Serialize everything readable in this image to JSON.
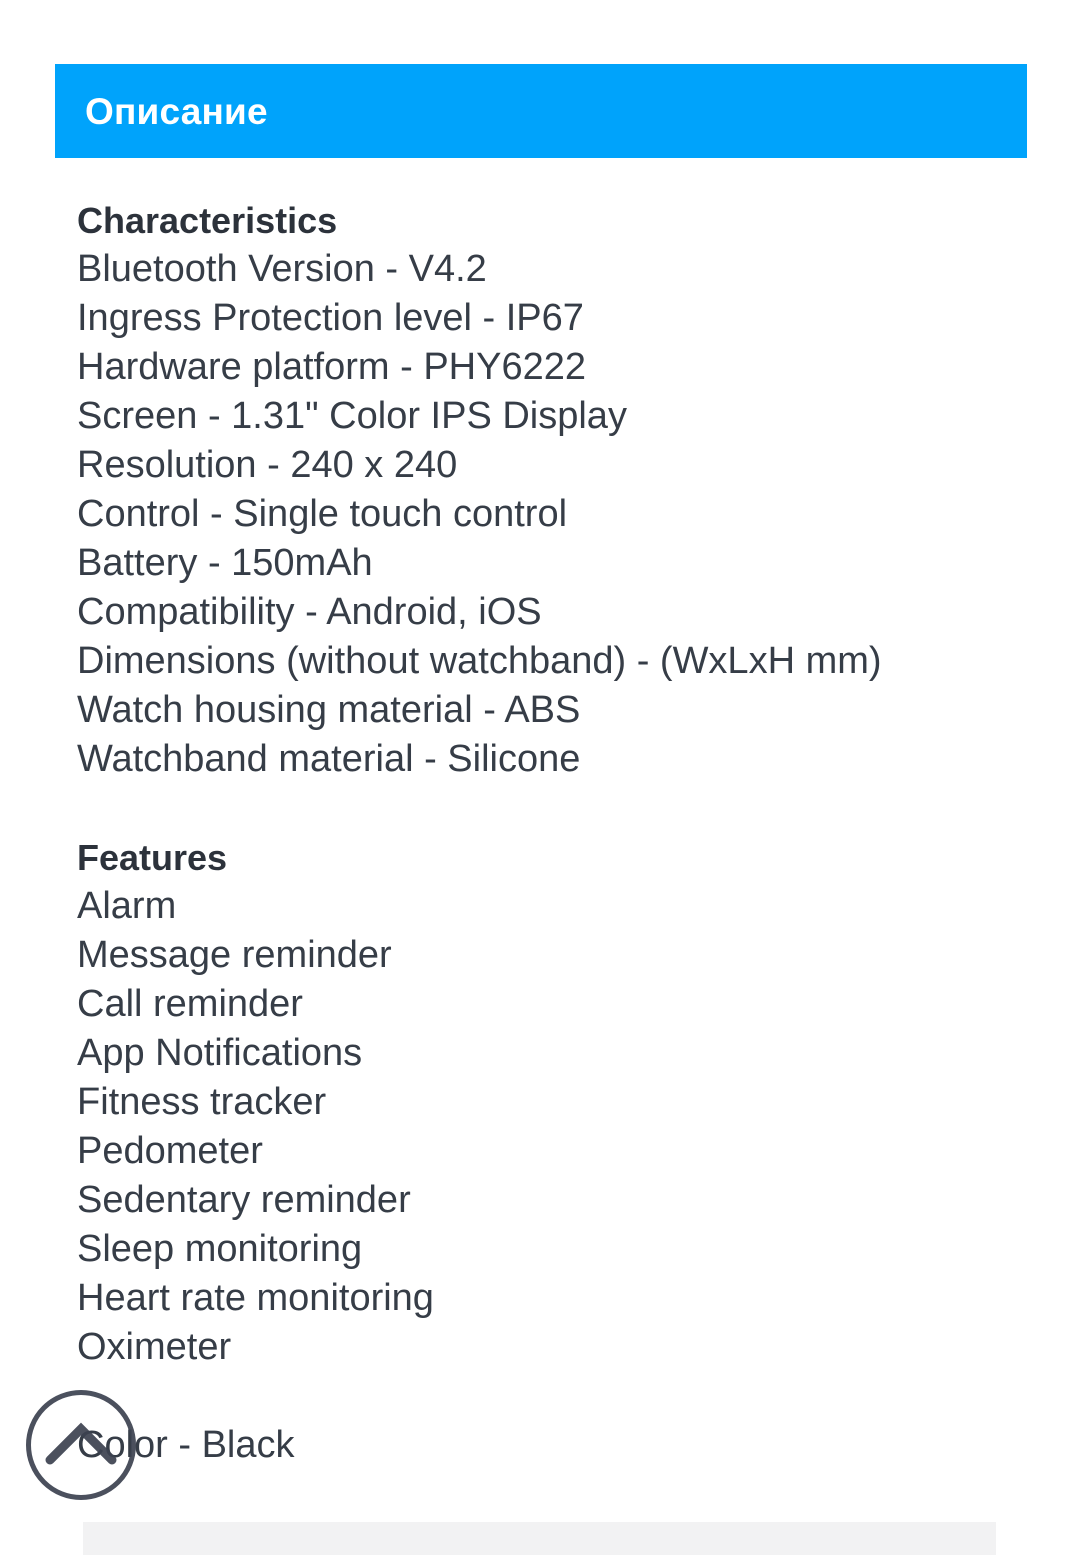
{
  "section": {
    "header_title": "Описание",
    "header_color": "#00a3fb",
    "header_text_color": "#ffffff"
  },
  "description": {
    "text_color": "#363d47",
    "characteristics": {
      "heading": "Characteristics",
      "lines": [
        "Bluetooth Version - V4.2",
        "Ingress Protection level - IP67",
        "Hardware platform - PHY6222",
        "Screen - 1.31\" Color IPS Display",
        "Resolution - 240 x 240",
        "Control - Single touch control",
        "Battery - 150mAh",
        "Compatibility - Android, iOS",
        "Dimensions (without watchband) - (WxLxH mm)",
        "Watch housing material - ABS",
        "Watchband material - Silicone"
      ]
    },
    "features": {
      "heading": "Features",
      "lines": [
        "Alarm",
        "Message reminder",
        "Call reminder",
        "App Notifications",
        "Fitness tracker",
        "Pedometer",
        "Sedentary reminder",
        "Sleep monitoring",
        "Heart rate monitoring",
        "Oximeter"
      ]
    },
    "color_line": "Color - Black"
  },
  "controls": {
    "scroll_top_icon": "chevron-up-icon",
    "scroll_top_color": "#3c4250"
  },
  "bottom_panel": {
    "background": "#f2f2f3"
  }
}
